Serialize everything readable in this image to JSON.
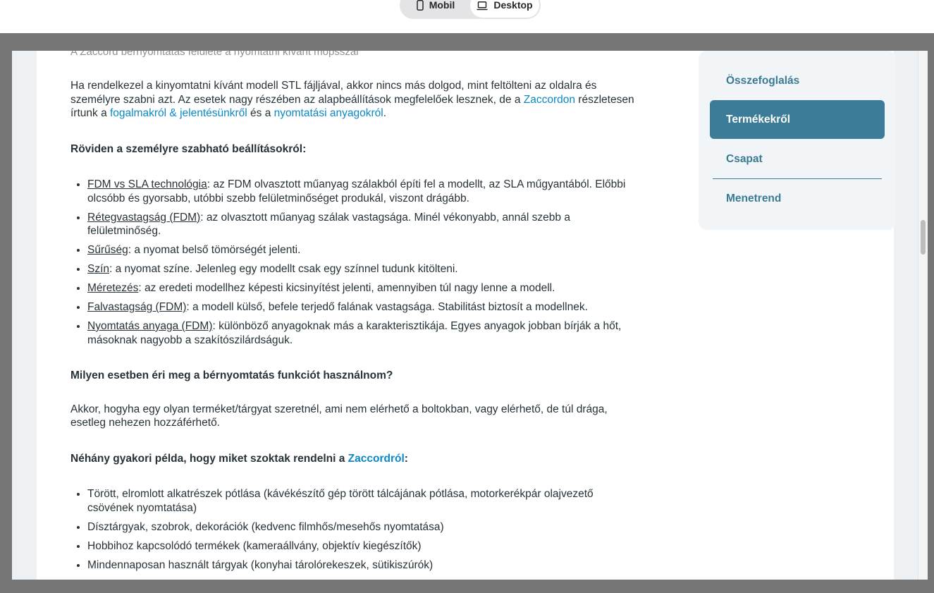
{
  "view_toggle": {
    "mobile_label": "Mobil",
    "desktop_label": "Desktop"
  },
  "article": {
    "caption": "A Zaccord bérnyomtatás felülete a nyomtatni kívánt mopsszal",
    "intro": {
      "text1": "Ha rendelkezel a kinyomtatni kívánt modell STL fájljával, akkor nincs más dolgod, mint feltölteni az oldalra és személyre szabni azt. Az esetek nagy részében az alapbeállítások megfelelőek lesznek, de a ",
      "link1": "Zaccordon",
      "text2": " részletesen írtunk a ",
      "link2": "fogalmakról & jelentésünkről",
      "text3": " és a ",
      "link3": "nyomtatási anyagokról",
      "text4": "."
    },
    "settings_heading": "Röviden a személyre szabható beállításokról:",
    "settings": [
      {
        "term": "FDM vs SLA technológia",
        "desc": ": az FDM olvasztott műanyag szálakból építi fel a modellt, az SLA műgyantából. Előbbi olcsóbb és gyorsabb, utóbbi szebb felületminőséget produkál, viszont drágább."
      },
      {
        "term": "Rétegvastagság (FDM)",
        "desc": ": az olvasztott műanyag szálak vastagsága. Minél vékonyabb, annál szebb a felületminőség."
      },
      {
        "term": "Sűrűség",
        "desc": ": a nyomat belső tömörségét jelenti."
      },
      {
        "term": "Szín",
        "desc": ": a nyomat színe. Jelenleg egy modellt csak egy színnel tudunk kitölteni."
      },
      {
        "term": "Méretezés",
        "desc": ": az eredeti modellhez képesti kicsinyítést jelenti, amennyiben túl nagy lenne a modell."
      },
      {
        "term": "Falvastagság (FDM)",
        "desc": ": a modell külső, befele terjedő falának vastagsága. Stabilitást biztosít a modellnek."
      },
      {
        "term": "Nyomtatás anyaga (FDM)",
        "desc": ": különböző anyagoknak más a karakterisztikája. Egyes anyagok jobban bírják a hőt, másoknak nagyobb a szakítószilárdságuk."
      }
    ],
    "when_heading": "Milyen esetben éri meg a bérnyomtatás funkciót használnom?",
    "when_text": "Akkor, hogyha egy olyan terméket/tárgyat szeretnél, ami nem elérhető a boltokban, vagy elérhető, de túl drága, esetleg nehezen hozzáférhető.",
    "examples_heading": {
      "prefix": "Néhány gyakori példa, hogy miket szoktak rendelni a ",
      "link": "Zaccordról",
      "suffix": ":"
    },
    "examples": [
      "Törött, elromlott alkatrészek pótlása (kávékészítő gép törött tálcájának pótlása, motorkerékpár olajvezető csövének nyomtatása)",
      "Dísztárgyak, szobrok, dekorációk (kedvenc filmhős/mesehős nyomtatása)",
      "Hobbihoz kapcsolódó termékek (kameraállvány, objektív kiegészítők)",
      "Mindennaposan használt tárgyak (konyhai tárolórekeszek, sütikiszúrók)"
    ]
  },
  "toc": {
    "items": [
      "Összefoglalás",
      "Termékekről",
      "Csapat",
      "Menetrend"
    ],
    "active": "Termékekről"
  },
  "colors": {
    "accent": "#3c7c98",
    "link": "#0b88c6",
    "text": "#263238"
  }
}
